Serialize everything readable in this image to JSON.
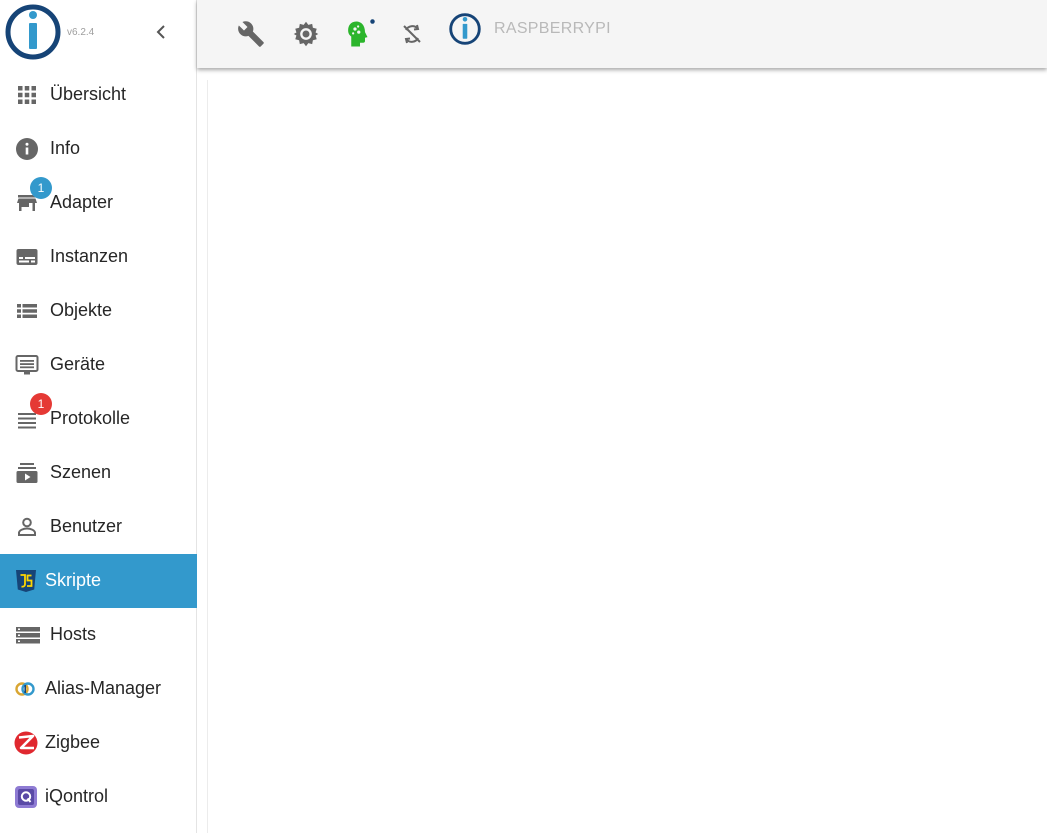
{
  "app": {
    "version": "v6.2.4",
    "host_name": "RASPBERRYPI",
    "colors": {
      "accent": "#3399cc",
      "logo_blue": "#164477",
      "badge_blue": "#3399cc",
      "badge_red": "#e53935",
      "agent_green": "#2bb52b"
    }
  },
  "sidebar": {
    "collapse_icon": "chevron-left-icon",
    "items": [
      {
        "label": "Übersicht",
        "icon": "grid-icon"
      },
      {
        "label": "Info",
        "icon": "info-icon"
      },
      {
        "label": "Adapter",
        "icon": "store-icon",
        "badge": "1"
      },
      {
        "label": "Instanzen",
        "icon": "subtitles-icon"
      },
      {
        "label": "Objekte",
        "icon": "view-list-icon"
      },
      {
        "label": "Geräte",
        "icon": "monitor-icon"
      },
      {
        "label": "Protokolle",
        "icon": "lines-icon",
        "badge": "1"
      },
      {
        "label": "Szenen",
        "icon": "subscriptions-icon"
      },
      {
        "label": "Benutzer",
        "icon": "person-icon"
      },
      {
        "label": "Skripte",
        "icon": "javascript-icon",
        "active": true
      },
      {
        "label": "Hosts",
        "icon": "storage-icon"
      },
      {
        "label": "Alias-Manager",
        "icon": "alias-rings-icon"
      },
      {
        "label": "Zigbee",
        "icon": "zigbee-icon"
      },
      {
        "label": "iQontrol",
        "icon": "iqontrol-icon"
      }
    ]
  },
  "toolbar": {
    "icons": [
      "wrench-icon",
      "settings-gear-icon",
      "discovery-head-icon",
      "sync-disabled-icon",
      "iobroker-logo-icon"
    ]
  }
}
